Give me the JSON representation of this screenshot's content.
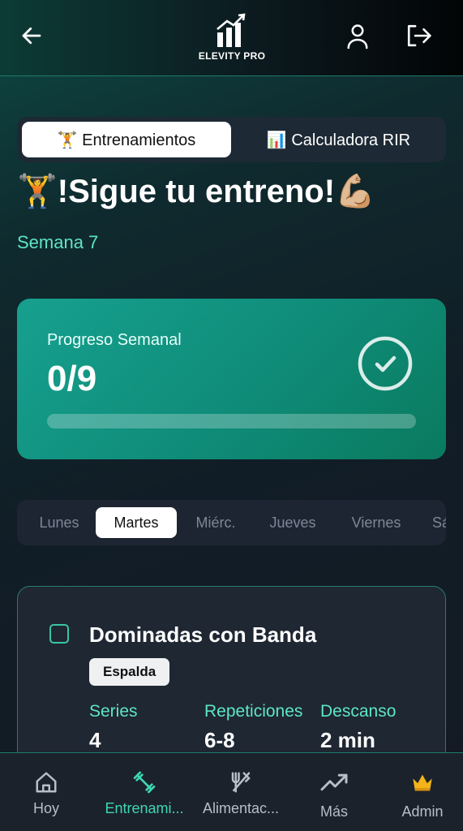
{
  "header": {
    "back_icon": "arrow-left-icon",
    "logo_text": "ELEVITY PRO",
    "profile_icon": "user-icon",
    "logout_icon": "logout-icon"
  },
  "tabs": [
    {
      "label": "🏋️ Entrenamientos",
      "active": true
    },
    {
      "label": "📊 Calculadora RIR",
      "active": false
    }
  ],
  "title": "🏋️!Sigue tu entreno!💪🏼",
  "week": "Semana 7",
  "progress": {
    "label": "Progreso Semanal",
    "value": "0/9",
    "completed": 0,
    "total": 9,
    "check_icon": "check-circle-icon"
  },
  "days": [
    {
      "label": "Lunes",
      "active": false
    },
    {
      "label": "Martes",
      "active": true
    },
    {
      "label": "Miérc.",
      "active": false
    },
    {
      "label": "Jueves",
      "active": false
    },
    {
      "label": "Viernes",
      "active": false
    },
    {
      "label": "Sá",
      "active": false
    }
  ],
  "exercise": {
    "name": "Dominadas con Banda",
    "tag": "Espalda",
    "columns": [
      {
        "label": "Series",
        "value": "4"
      },
      {
        "label": "Repeticiones",
        "value": "6-8"
      },
      {
        "label": "Descanso",
        "value": "2 min"
      }
    ]
  },
  "nav": [
    {
      "label": "Hoy",
      "icon": "home-icon",
      "active": false
    },
    {
      "label": "Entrenami...",
      "icon": "dumbbell-icon",
      "active": true
    },
    {
      "label": "Alimentac...",
      "icon": "utensils-icon",
      "active": false
    },
    {
      "label": "Más",
      "icon": "trending-up-icon",
      "active": false
    },
    {
      "label": "Admin",
      "icon": "crown-icon",
      "active": false
    }
  ],
  "colors": {
    "accent": "#3fd6b4",
    "card_green": "#0f8c79",
    "bg_dark": "#141a24"
  }
}
